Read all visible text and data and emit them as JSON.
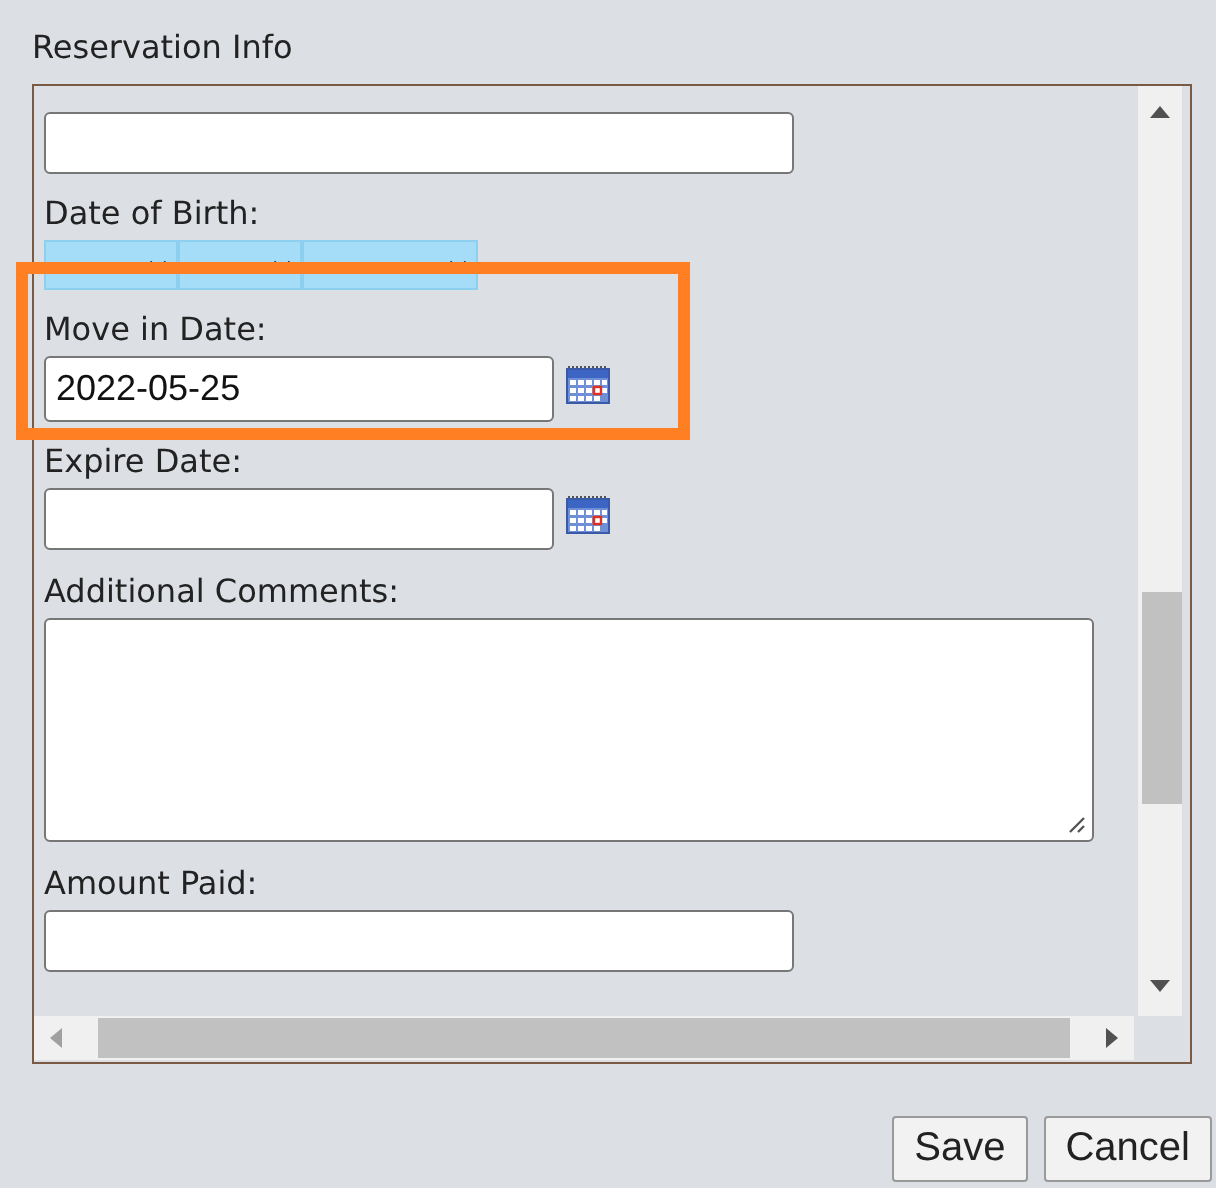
{
  "panel": {
    "title": "Reservation Info"
  },
  "fields": [
    {
      "kind": "text"
    },
    {
      "kind": "date_select",
      "label": "Date of Birth:",
      "parts": [
        {
          "kind": "month"
        },
        {
          "kind": "day"
        },
        {
          "kind": "year"
        }
      ]
    },
    {
      "kind": "date",
      "label": "Move in Date:",
      "value": "2022-05-25",
      "highlighted": true
    },
    {
      "kind": "date",
      "label": "Expire Date:",
      "highlighted": false
    },
    {
      "kind": "textarea",
      "label": "Additional Comments:"
    },
    {
      "kind": "text",
      "label": "Amount Paid:"
    }
  ],
  "buttons": [
    "Save",
    "Cancel"
  ]
}
